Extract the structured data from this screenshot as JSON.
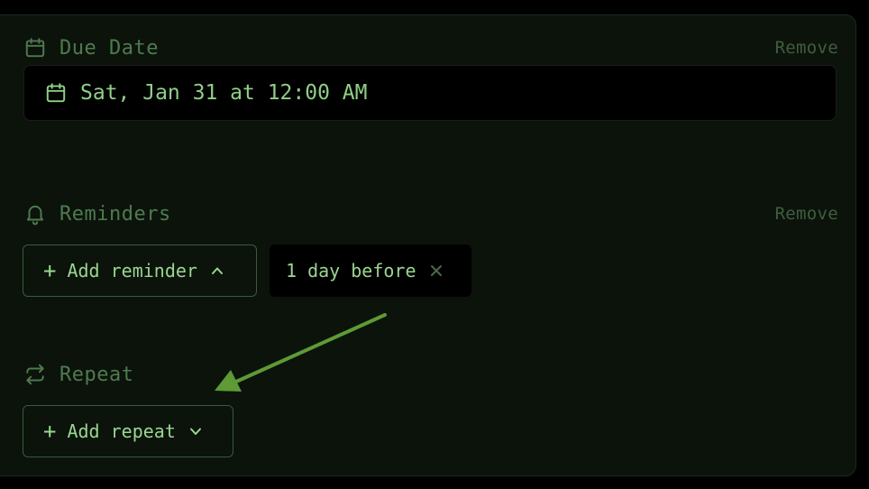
{
  "due_date": {
    "title": "Due Date",
    "remove_label": "Remove",
    "value": "Sat, Jan 31 at 12:00 AM",
    "icon": "calendar-icon"
  },
  "reminders": {
    "title": "Reminders",
    "remove_label": "Remove",
    "add_label": "Add reminder",
    "chip_label": "1 day before",
    "icon": "bell-icon"
  },
  "repeat": {
    "title": "Repeat",
    "add_label": "Add repeat",
    "icon": "repeat-icon"
  },
  "colors": {
    "background": "#000000",
    "panel": "#0b130b",
    "accent_text": "#9ad690",
    "muted_text": "#4f7a4f",
    "annotation_arrow": "#5e9a36"
  }
}
